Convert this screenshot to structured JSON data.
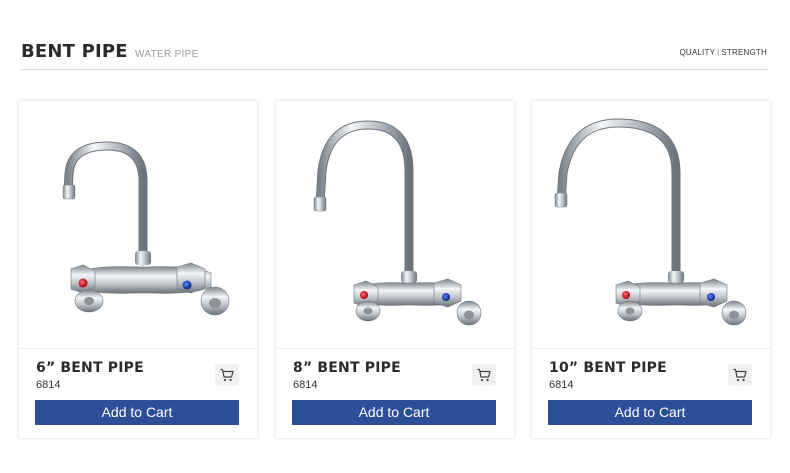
{
  "header": {
    "title": "BENT PIPE",
    "subtitle": "WATER PIPE",
    "tag_left": "QUALITY",
    "tag_separator": "|",
    "tag_right": "STRENGTH"
  },
  "products": [
    {
      "name": "6” BENT PIPE",
      "sku": "6814",
      "button_label": "Add to Cart",
      "cart_icon": "cart-icon"
    },
    {
      "name": "8” BENT PIPE",
      "sku": "6814",
      "button_label": "Add to Cart",
      "cart_icon": "cart-icon"
    },
    {
      "name": "10” BENT PIPE",
      "sku": "6814",
      "button_label": "Add to Cart",
      "cart_icon": "cart-icon"
    }
  ],
  "colors": {
    "button": "#2d4e98",
    "hot_knob": "#cc1a24",
    "cold_knob": "#1a3fb5",
    "chrome": "#c9cdd2"
  }
}
